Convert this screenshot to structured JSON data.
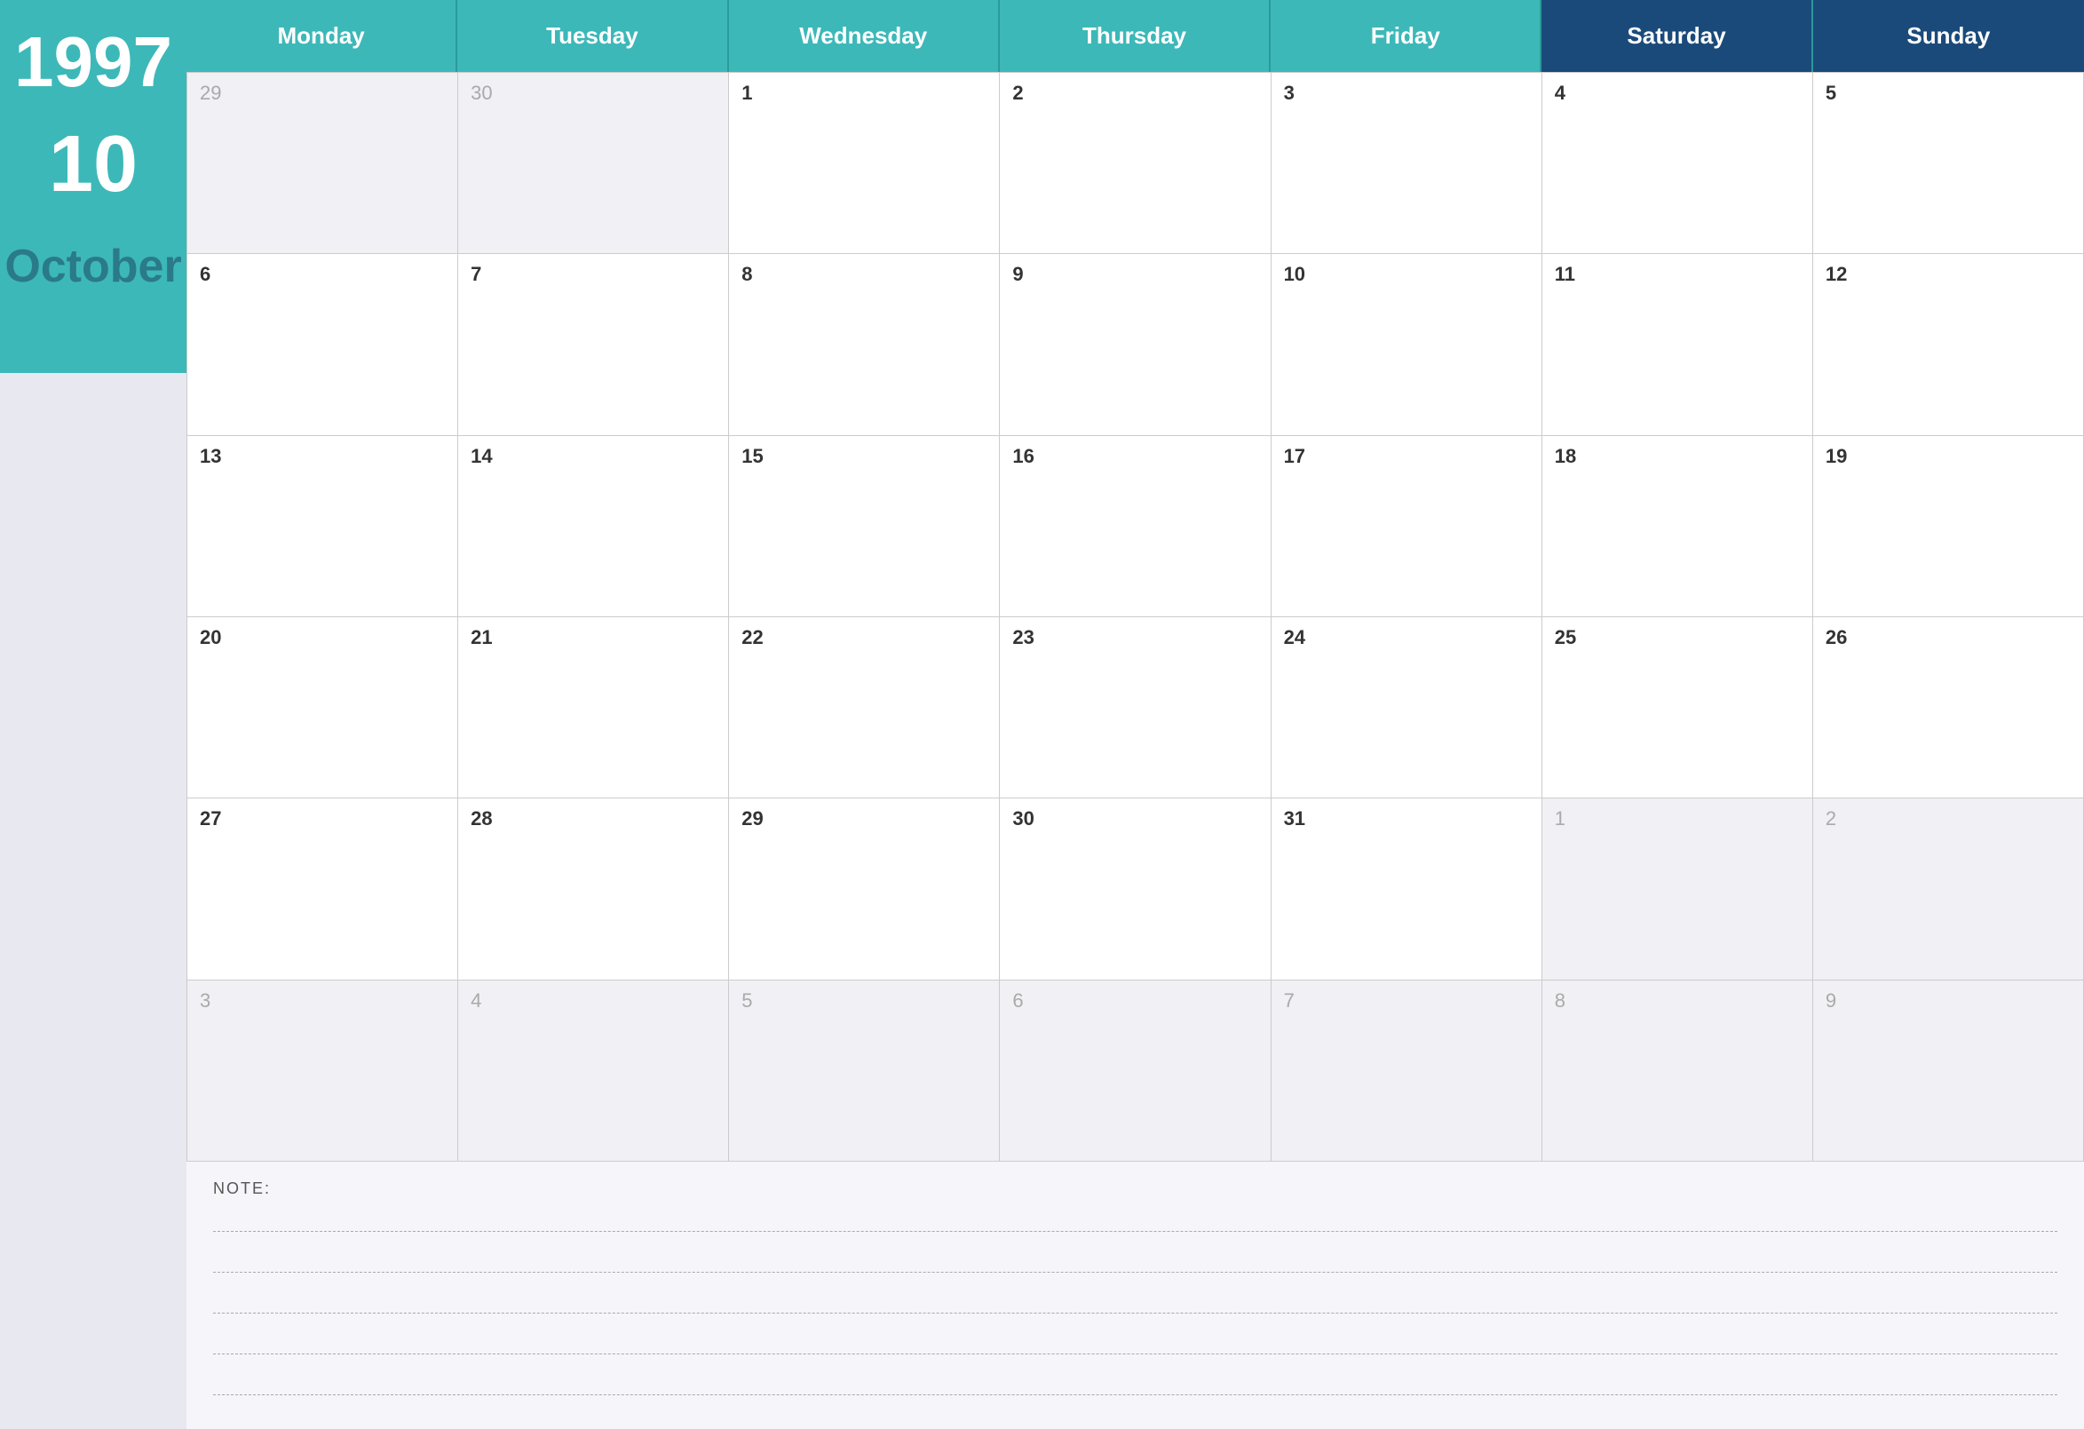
{
  "sidebar": {
    "year": "1997",
    "month_num": "10",
    "month_name": "October"
  },
  "header": {
    "days": [
      "Monday",
      "Tuesday",
      "Wednesday",
      "Thursday",
      "Friday",
      "Saturday",
      "Sunday"
    ]
  },
  "grid": {
    "weeks": [
      [
        {
          "num": "29",
          "other": true
        },
        {
          "num": "30",
          "other": true
        },
        {
          "num": "1",
          "other": false
        },
        {
          "num": "2",
          "other": false
        },
        {
          "num": "3",
          "other": false
        },
        {
          "num": "4",
          "other": false
        },
        {
          "num": "5",
          "other": false
        }
      ],
      [
        {
          "num": "6",
          "other": false
        },
        {
          "num": "7",
          "other": false
        },
        {
          "num": "8",
          "other": false
        },
        {
          "num": "9",
          "other": false
        },
        {
          "num": "10",
          "other": false
        },
        {
          "num": "11",
          "other": false
        },
        {
          "num": "12",
          "other": false
        }
      ],
      [
        {
          "num": "13",
          "other": false
        },
        {
          "num": "14",
          "other": false
        },
        {
          "num": "15",
          "other": false
        },
        {
          "num": "16",
          "other": false
        },
        {
          "num": "17",
          "other": false
        },
        {
          "num": "18",
          "other": false
        },
        {
          "num": "19",
          "other": false
        }
      ],
      [
        {
          "num": "20",
          "other": false
        },
        {
          "num": "21",
          "other": false
        },
        {
          "num": "22",
          "other": false
        },
        {
          "num": "23",
          "other": false
        },
        {
          "num": "24",
          "other": false
        },
        {
          "num": "25",
          "other": false
        },
        {
          "num": "26",
          "other": false
        }
      ],
      [
        {
          "num": "27",
          "other": false
        },
        {
          "num": "28",
          "other": false
        },
        {
          "num": "29",
          "other": false
        },
        {
          "num": "30",
          "other": false
        },
        {
          "num": "31",
          "other": false
        },
        {
          "num": "1",
          "other": true
        },
        {
          "num": "2",
          "other": true
        }
      ],
      [
        {
          "num": "3",
          "other": true
        },
        {
          "num": "4",
          "other": true
        },
        {
          "num": "5",
          "other": true
        },
        {
          "num": "6",
          "other": true
        },
        {
          "num": "7",
          "other": true
        },
        {
          "num": "8",
          "other": true
        },
        {
          "num": "9",
          "other": true
        }
      ]
    ]
  },
  "notes": {
    "label": "NOTE:",
    "lines": [
      "",
      "",
      "",
      "",
      ""
    ]
  }
}
